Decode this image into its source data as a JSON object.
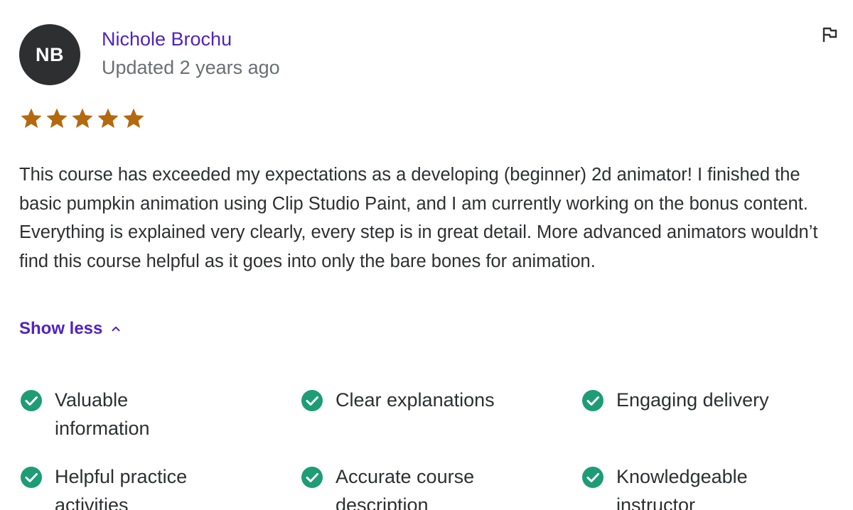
{
  "reviewer": {
    "initials": "NB",
    "name": "Nichole Brochu",
    "updated": "Updated 2 years ago"
  },
  "rating": {
    "stars": 5,
    "max": 5,
    "color": "#b4690e"
  },
  "review_text": "This course has exceeded my expectations as a developing (beginner) 2d animator! I finished the basic pumpkin animation using Clip Studio Paint, and I am currently working on the bonus content. Everything is explained very clearly, every step is in great detail. More advanced animators wouldn’t find this course helpful as it goes into only the bare bones for animation.",
  "show_less_label": "Show less",
  "tags": [
    {
      "label": "Valuable information"
    },
    {
      "label": "Clear explanations"
    },
    {
      "label": "Engaging delivery"
    },
    {
      "label": "Helpful practice activities"
    },
    {
      "label": "Accurate course description"
    },
    {
      "label": "Knowledgeable instructor"
    }
  ],
  "icons": {
    "flag": "flag-icon",
    "star": "star-icon",
    "chevron": "chevron-up-icon",
    "check": "check-circle-icon"
  },
  "colors": {
    "accent": "#5022c3",
    "avatar_bg": "#2d2f31",
    "check": "#1e9c75",
    "muted": "#6a6f73"
  }
}
